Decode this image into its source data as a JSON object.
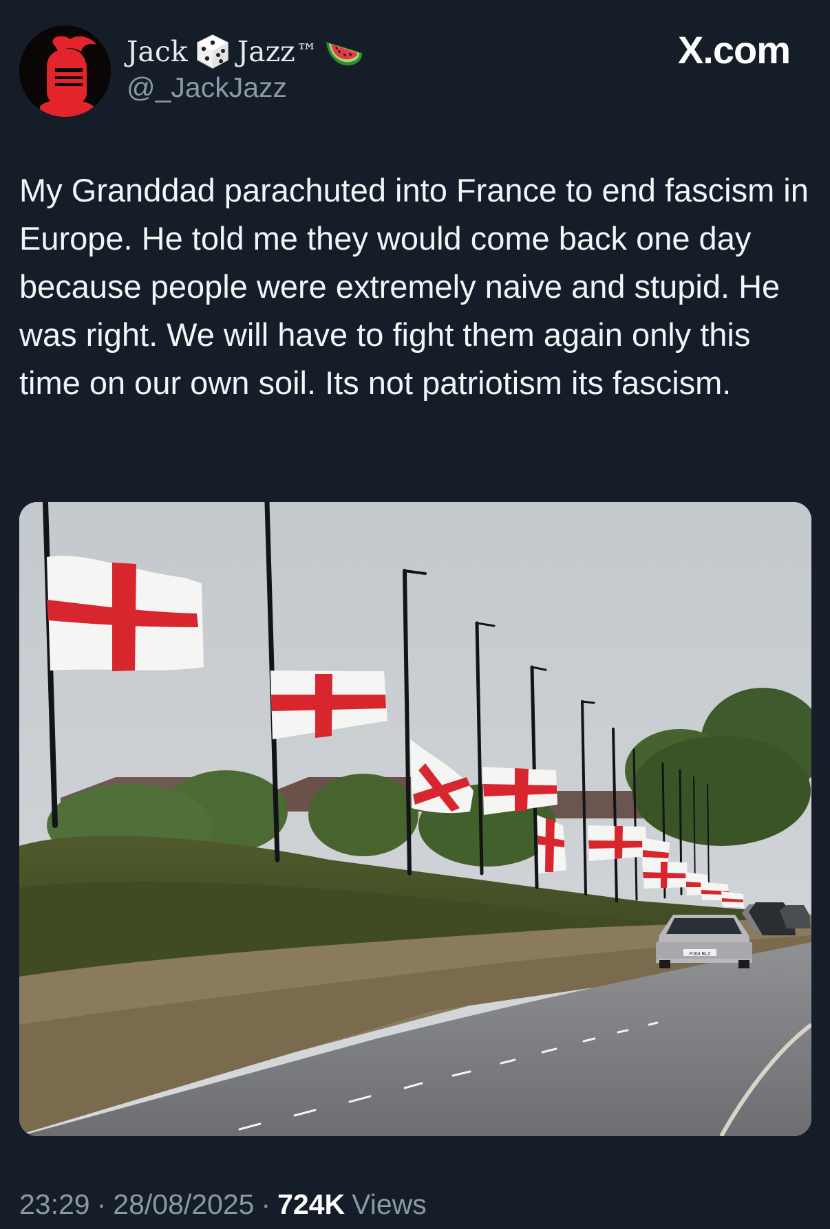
{
  "author": {
    "name_first": "Jack",
    "name_last": "Jazz",
    "name_suffix": "™",
    "handle": "@_JackJazz",
    "emoji_1": "dice-icon",
    "emoji_2": "watermelon-icon"
  },
  "brand": "X.com",
  "tweet": {
    "text": "My Granddad parachuted into France to end fascism in Europe. He told me they would come back one day because people were extremely naive and stupid. He was right. We will have to fight them again only this time on our own soil. Its not patriotism its fascism."
  },
  "media": {
    "license_plate": "PJ04 BLZ"
  },
  "meta": {
    "time": "23:29",
    "separator": "·",
    "date": "28/08/2025",
    "views_count": "724K",
    "views_label": "Views"
  },
  "colors": {
    "background": "#151d28",
    "secondary_text": "#8b98a5",
    "primary_text": "#ffffff",
    "flag_red": "#d7262d"
  }
}
